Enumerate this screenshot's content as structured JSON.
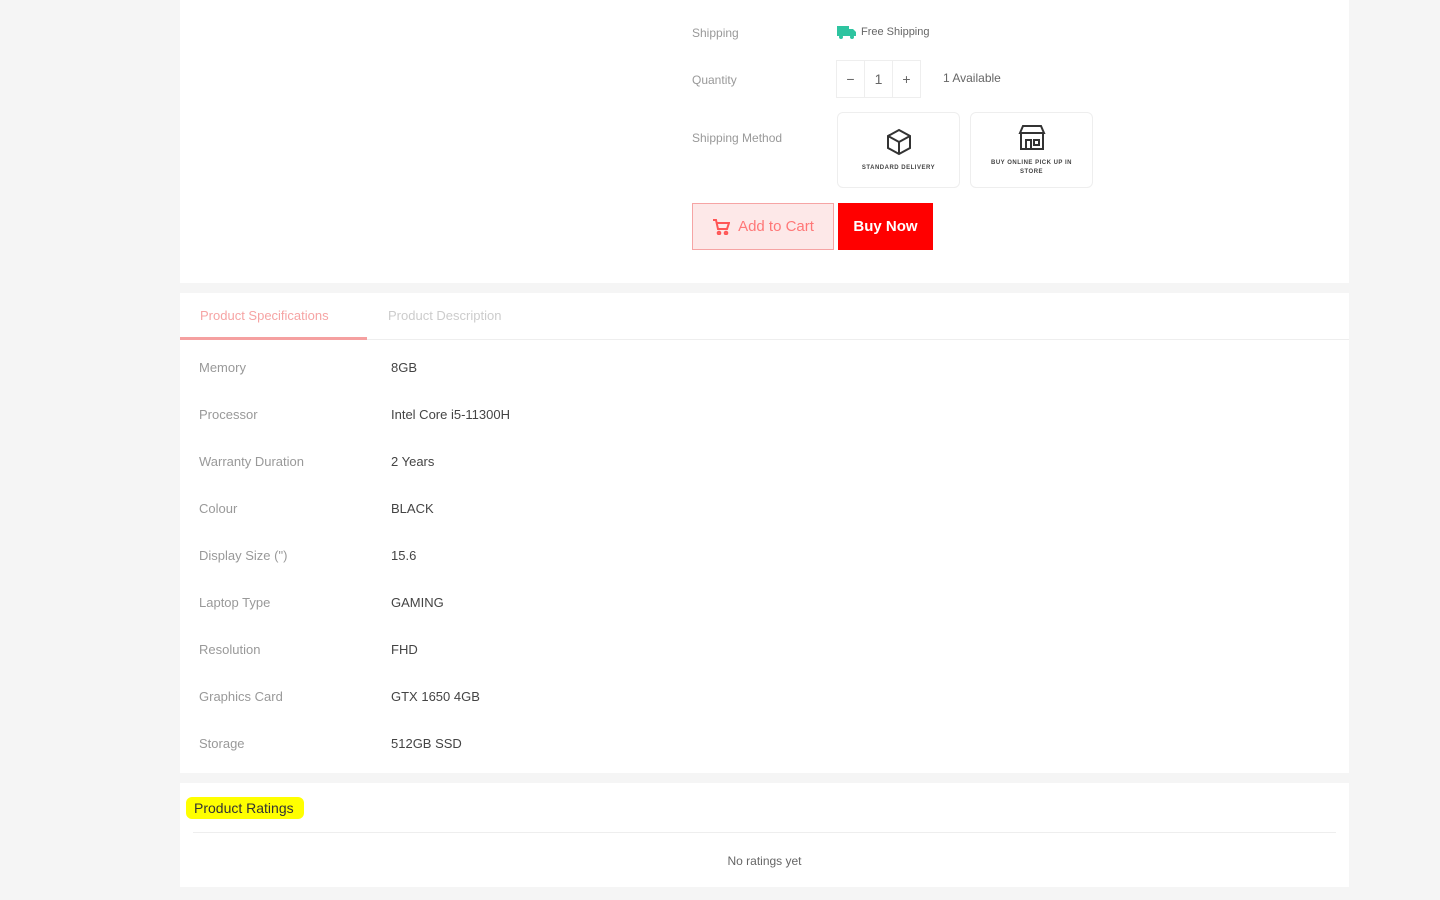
{
  "purchase": {
    "shipping_label": "Shipping",
    "shipping_value": "Free Shipping",
    "quantity_label": "Quantity",
    "quantity": "1",
    "available": "1 Available",
    "method_label": "Shipping Method",
    "methods": [
      {
        "label": "STANDARD DELIVERY",
        "icon": "box-icon"
      },
      {
        "label": "BUY ONLINE PICK UP IN STORE",
        "icon": "store-icon"
      }
    ],
    "add_to_cart": "Add to Cart",
    "buy_now": "Buy Now"
  },
  "tabs": [
    {
      "label": "Product Specifications",
      "active": true
    },
    {
      "label": "Product Description",
      "active": false
    }
  ],
  "specs": [
    {
      "k": "Memory",
      "v": "8GB"
    },
    {
      "k": "Processor",
      "v": "Intel Core i5-11300H"
    },
    {
      "k": "Warranty Duration",
      "v": "2 Years"
    },
    {
      "k": "Colour",
      "v": "BLACK"
    },
    {
      "k": "Display Size (\")",
      "v": "15.6"
    },
    {
      "k": "Laptop Type",
      "v": "GAMING"
    },
    {
      "k": "Resolution",
      "v": "FHD"
    },
    {
      "k": "Graphics Card",
      "v": "GTX 1650 4GB"
    },
    {
      "k": "Storage",
      "v": "512GB SSD"
    }
  ],
  "ratings": {
    "title": "Product Ratings",
    "empty": "No ratings yet"
  },
  "colors": {
    "accent": "#ff0000",
    "highlight": "#ffff00",
    "shipping": "#2ec4a0"
  }
}
